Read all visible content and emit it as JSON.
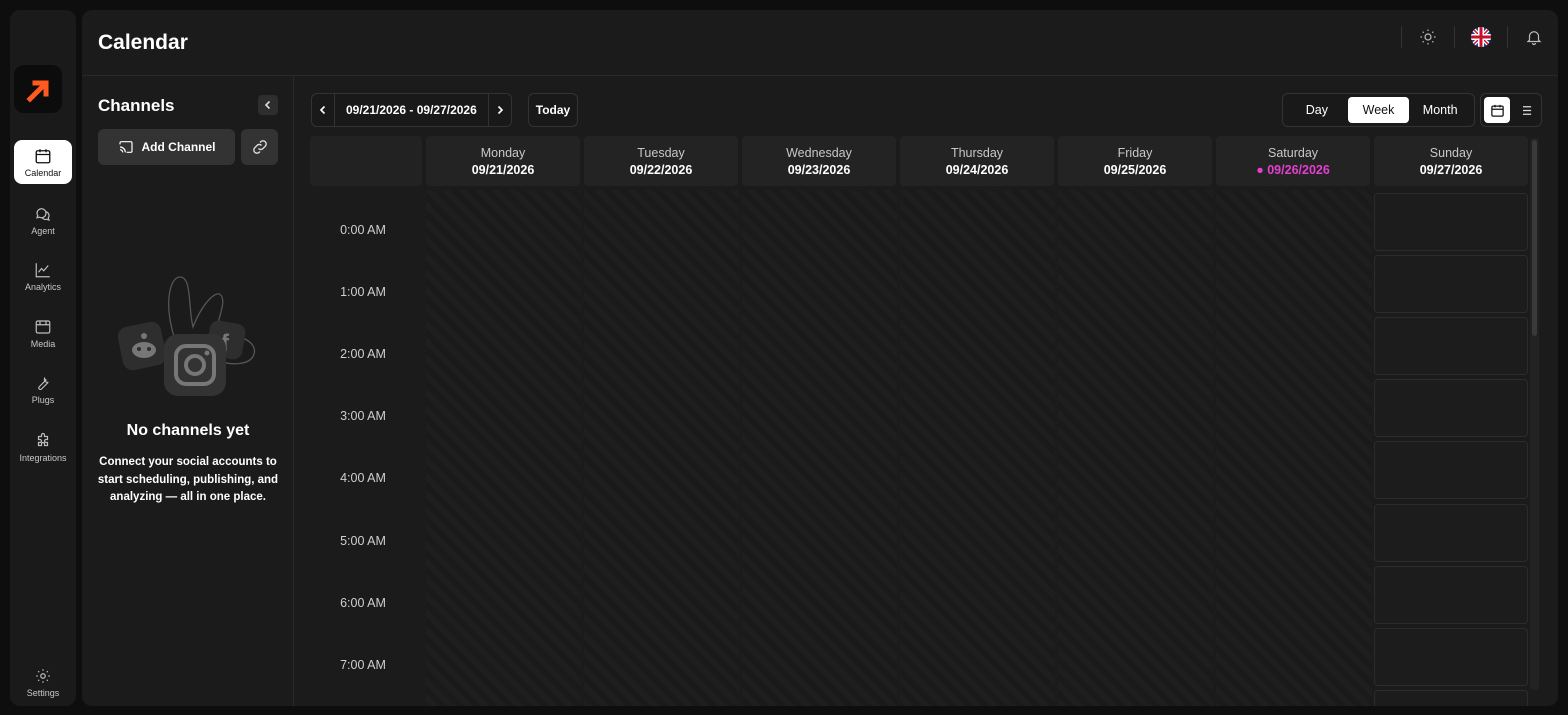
{
  "nav": {
    "items": [
      {
        "label": "Calendar",
        "icon": "calendar-icon",
        "active": true
      },
      {
        "label": "Agent",
        "icon": "chat-bubbles-icon"
      },
      {
        "label": "Analytics",
        "icon": "trend-chart-icon"
      },
      {
        "label": "Media",
        "icon": "media-icon"
      },
      {
        "label": "Plugs",
        "icon": "wrench-icon"
      },
      {
        "label": "Integrations",
        "icon": "puzzle-icon"
      }
    ],
    "settings_label": "Settings"
  },
  "header": {
    "title": "Calendar"
  },
  "channels": {
    "title": "Channels",
    "add_label": "Add Channel",
    "empty_title": "No channels yet",
    "empty_desc": "Connect your social accounts to start scheduling, publishing, and analyzing — all in one place."
  },
  "calendar": {
    "date_range": "09/21/2026 - 09/27/2026",
    "today_label": "Today",
    "views": [
      {
        "label": "Day"
      },
      {
        "label": "Week",
        "active": true
      },
      {
        "label": "Month"
      }
    ],
    "days": [
      {
        "name": "Monday",
        "date": "09/21/2026"
      },
      {
        "name": "Tuesday",
        "date": "09/22/2026"
      },
      {
        "name": "Wednesday",
        "date": "09/23/2026"
      },
      {
        "name": "Thursday",
        "date": "09/24/2026"
      },
      {
        "name": "Friday",
        "date": "09/25/2026"
      },
      {
        "name": "Saturday",
        "date": "09/26/2026",
        "today": true
      },
      {
        "name": "Sunday",
        "date": "09/27/2026"
      }
    ],
    "hours": [
      "0:00 AM",
      "1:00 AM",
      "2:00 AM",
      "3:00 AM",
      "4:00 AM",
      "5:00 AM",
      "6:00 AM",
      "7:00 AM"
    ]
  },
  "colors": {
    "accent": "#ff5a1f",
    "today": "#e53ed0",
    "background": "#1b1b1b"
  }
}
